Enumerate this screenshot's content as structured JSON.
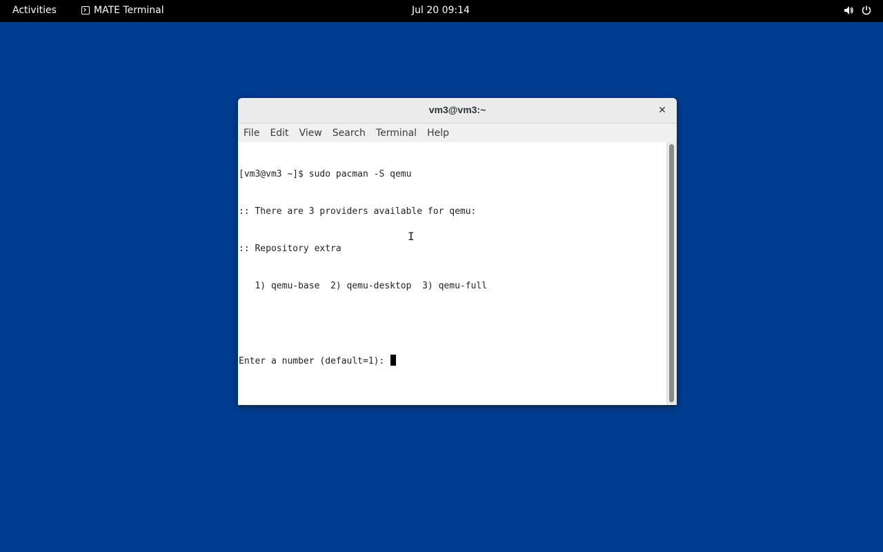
{
  "topbar": {
    "activities_label": "Activities",
    "app_name": "MATE Terminal",
    "app_icon": "terminal-icon",
    "clock": "Jul 20  09:14",
    "tray_icons": [
      "volume-icon",
      "power-icon"
    ]
  },
  "window": {
    "title": "vm3@vm3:~",
    "close_glyph": "✕",
    "menu": {
      "file": "File",
      "edit": "Edit",
      "view": "View",
      "search": "Search",
      "terminal": "Terminal",
      "help": "Help"
    },
    "terminal_lines": [
      "[vm3@vm3 ~]$ sudo pacman -S qemu",
      ":: There are 3 providers available for qemu:",
      ":: Repository extra",
      "   1) qemu-base  2) qemu-desktop  3) qemu-full",
      "",
      "Enter a number (default=1): "
    ]
  },
  "colors": {
    "desktop_background": "#003c8f",
    "topbar_background": "#000000",
    "terminal_background": "#ffffff",
    "terminal_text": "#222222"
  }
}
